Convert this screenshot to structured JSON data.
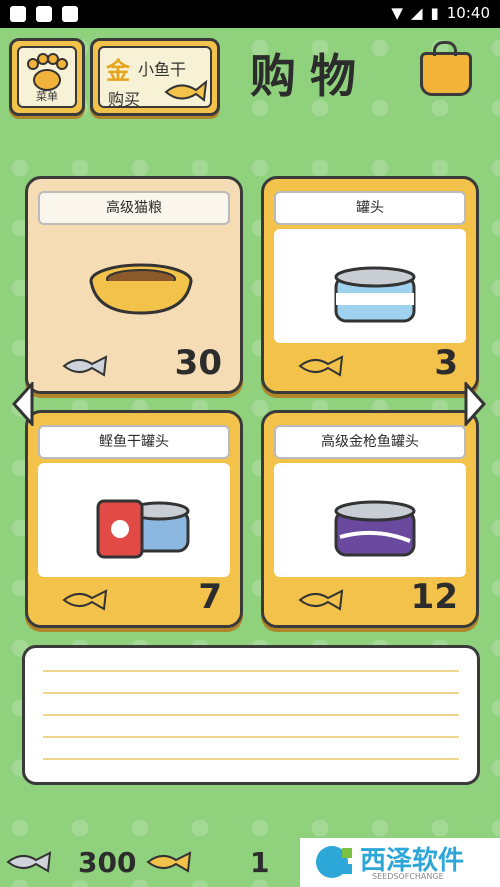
{
  "status_bar": {
    "time": "10:40"
  },
  "header": {
    "menu_label": "菜单",
    "buy": {
      "gold_char": "金",
      "top_text": "小鱼干",
      "bottom_text": "购买"
    },
    "title": "购物"
  },
  "cards": [
    {
      "label": "高级猫粮",
      "price": "30",
      "selected": true
    },
    {
      "label": "罐头",
      "price": "3",
      "selected": false
    },
    {
      "label": "鲣鱼干罐头",
      "price": "7",
      "selected": false
    },
    {
      "label": "高级金枪鱼罐头",
      "price": "12",
      "selected": false
    }
  ],
  "bottom": {
    "silver_fish": "300",
    "gold_fish": "1"
  },
  "watermark": {
    "title": "西泽软件",
    "subtitle": "SEEDSOFCHANGE"
  },
  "colors": {
    "background": "#8fd17d",
    "card": "#f2c24a",
    "selected_card": "#f5dcb5",
    "gold": "#e6a51e"
  }
}
